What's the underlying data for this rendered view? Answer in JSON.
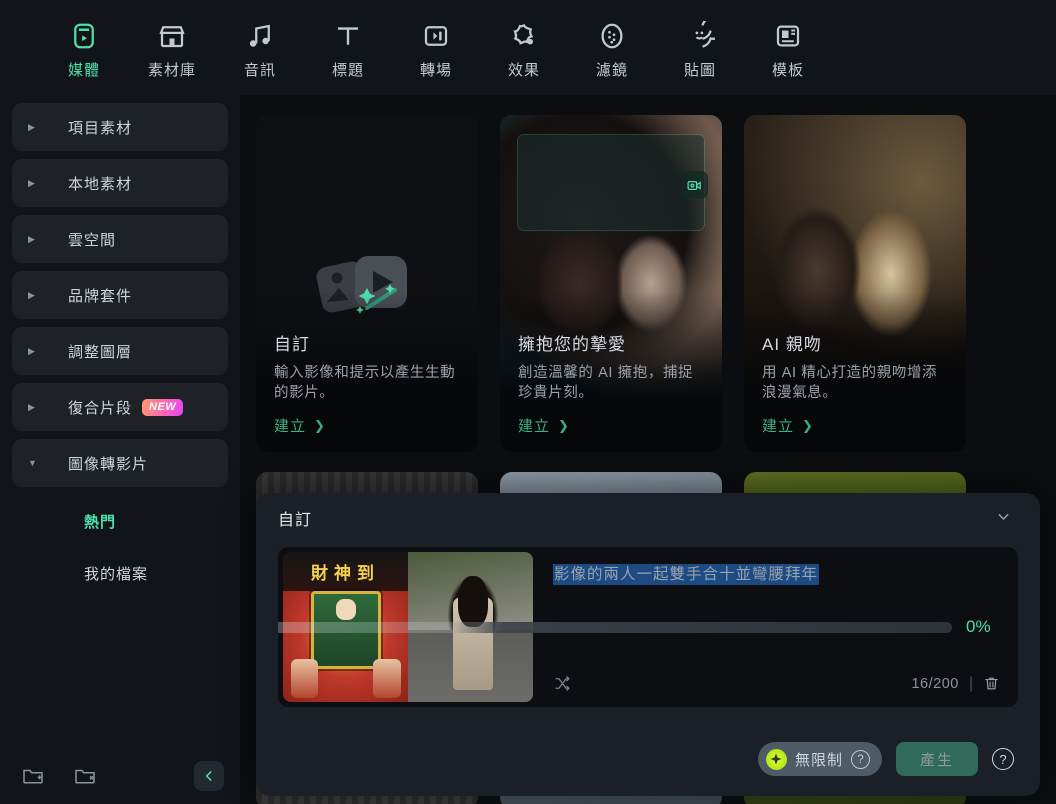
{
  "topnav": {
    "items": [
      {
        "label": "媒體",
        "icon": "media-icon",
        "active": true
      },
      {
        "label": "素材庫",
        "icon": "stock-library-icon",
        "active": false
      },
      {
        "label": "音訊",
        "icon": "audio-icon",
        "active": false
      },
      {
        "label": "標題",
        "icon": "title-text-icon",
        "active": false
      },
      {
        "label": "轉場",
        "icon": "transition-icon",
        "active": false
      },
      {
        "label": "效果",
        "icon": "effects-icon",
        "active": false
      },
      {
        "label": "濾鏡",
        "icon": "filter-icon",
        "active": false
      },
      {
        "label": "貼圖",
        "icon": "sticker-icon",
        "active": false
      },
      {
        "label": "模板",
        "icon": "template-icon",
        "active": false
      }
    ]
  },
  "sidebar": {
    "items": [
      {
        "label": "項目素材",
        "expanded": false
      },
      {
        "label": "本地素材",
        "expanded": false
      },
      {
        "label": "雲空間",
        "expanded": false
      },
      {
        "label": "品牌套件",
        "expanded": false
      },
      {
        "label": "調整圖層",
        "expanded": false
      },
      {
        "label": "復合片段",
        "expanded": false,
        "badge": "NEW"
      },
      {
        "label": "圖像轉影片",
        "expanded": true
      }
    ],
    "subitems": [
      {
        "label": "熱門",
        "active": true
      },
      {
        "label": "我的檔案",
        "active": false
      }
    ],
    "footer": {
      "new_folder_icon": "folder-add-icon",
      "delete_folder_icon": "folder-remove-icon",
      "collapse_icon": "chevron-left-icon"
    }
  },
  "main": {
    "cards": [
      {
        "title": "自訂",
        "desc": "輸入影像和提示以產生生動的影片。",
        "cta": "建立",
        "art": "placeholder",
        "has_share": false
      },
      {
        "title": "擁抱您的摯愛",
        "desc": "創造溫馨的 AI 擁抱，捕捉珍貴片刻。",
        "cta": "建立",
        "art": "hug",
        "has_share": true,
        "share_icon": "video-share-icon"
      },
      {
        "title": "AI 親吻",
        "desc": "用 AI 精心打造的親吻增添浪漫氣息。",
        "cta": "建立",
        "art": "kiss",
        "has_share": false
      },
      {
        "title": "",
        "desc": "",
        "cta": "",
        "art": "grey",
        "has_share": false
      },
      {
        "title": "",
        "desc": "",
        "cta": "",
        "art": "blonde",
        "has_share": false
      },
      {
        "title": "",
        "desc": "",
        "cta": "",
        "art": "green",
        "has_share": false
      }
    ]
  },
  "panel": {
    "title": "自訂",
    "collapse_icon": "chevron-down-icon",
    "thumbnail": {
      "left_caption": "財神到",
      "alt": "split-image-thumbnail"
    },
    "prompt_value": "影像的兩人一起雙手合十並彎腰拜年",
    "progress": {
      "percent_label": "0%",
      "value": 0
    },
    "shuffle_icon": "shuffle-icon",
    "counter": "16/200",
    "trash_icon": "trash-icon",
    "unlimited": {
      "label": "無限制",
      "spark_icon": "sparkle-icon",
      "help_icon": "question-mark-icon"
    },
    "generate": {
      "label": "產生",
      "help_icon": "question-mark-icon"
    }
  },
  "colors": {
    "accent_teal": "#4fe0ab",
    "cta_green": "#3fae82",
    "selection_blue": "#1b4b82",
    "generate_bg": "#2f6b58",
    "badge_new_from": "#ff9a6b",
    "badge_new_to": "#e545f5",
    "panel_bg": "#1b2028",
    "app_bg": "#0b0d10"
  }
}
